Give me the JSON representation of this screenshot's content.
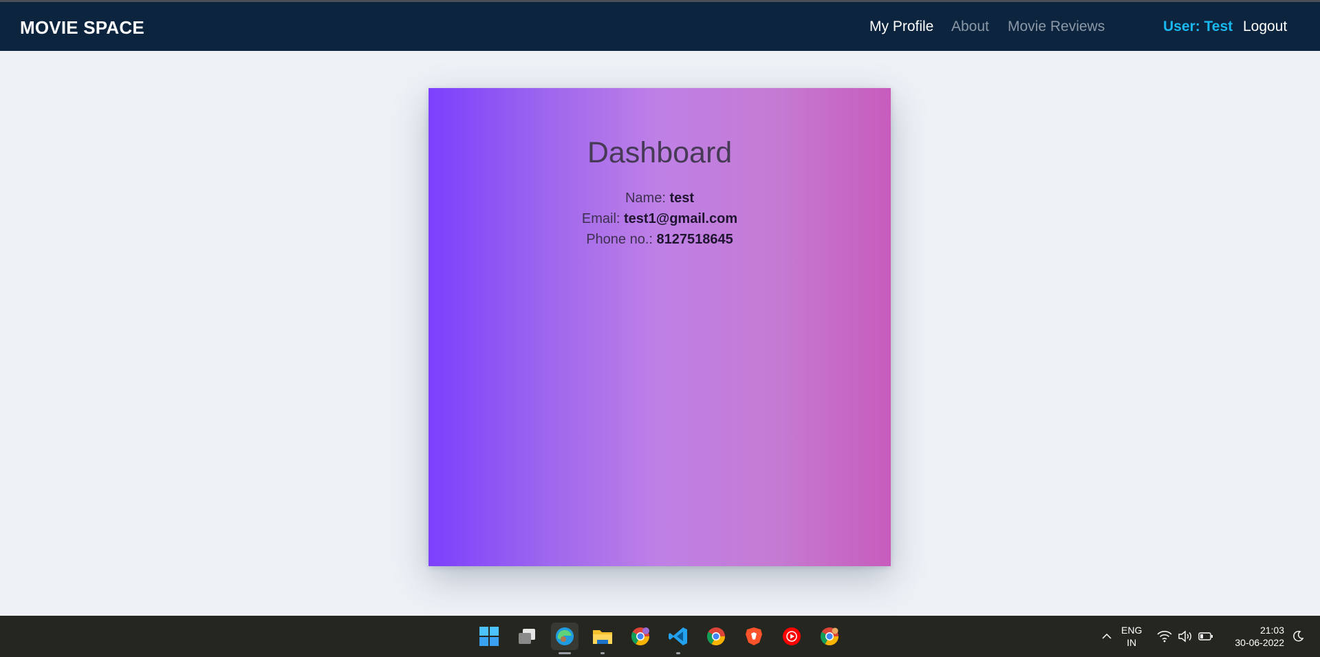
{
  "navbar": {
    "brand": "MOVIE SPACE",
    "links": [
      {
        "label": "My Profile"
      },
      {
        "label": "About"
      },
      {
        "label": "Movie Reviews"
      }
    ],
    "user_label": "User: Test",
    "logout_label": "Logout"
  },
  "dashboard": {
    "title": "Dashboard",
    "fields": [
      {
        "label": "Name: ",
        "value": "test"
      },
      {
        "label": "Email: ",
        "value": "test1@gmail.com"
      },
      {
        "label": "Phone no.: ",
        "value": "8127518645"
      }
    ]
  },
  "taskbar": {
    "apps": [
      "windows-start-icon",
      "task-view-icon",
      "edge-icon",
      "file-explorer-icon",
      "chrome-profile-icon",
      "vscode-icon",
      "chrome-icon",
      "brave-icon",
      "youtube-music-icon",
      "chrome-alt-icon"
    ],
    "lang_line1": "ENG",
    "lang_line2": "IN",
    "time": "21:03",
    "date": "30-06-2022"
  },
  "colors": {
    "navbar_bg": "#0c243d",
    "user_accent": "#1ab8f0",
    "card_gradient_start": "#7c3ffd",
    "card_gradient_end": "#c75cbd"
  }
}
